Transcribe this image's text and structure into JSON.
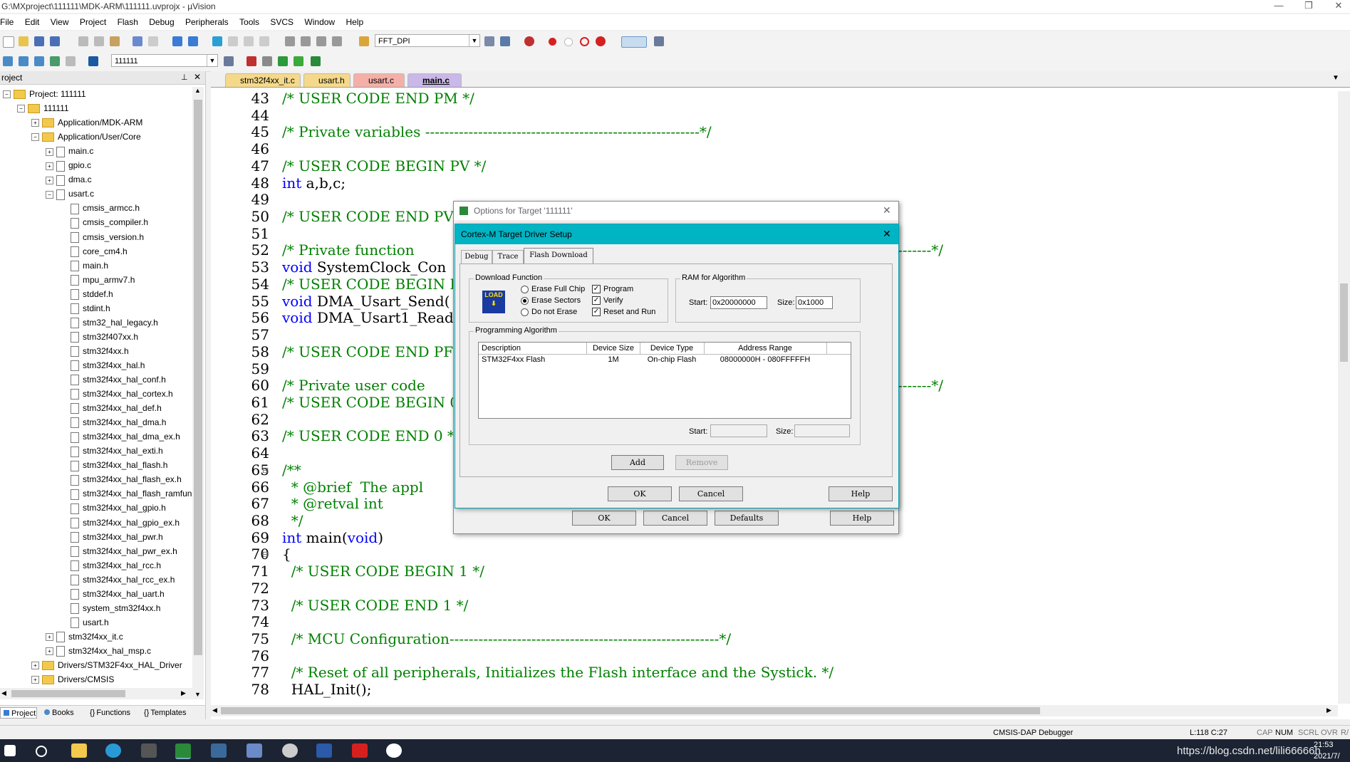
{
  "window": {
    "title": "G:\\MXproject\\111111\\MDK-ARM\\111111.uvprojx - µVision"
  },
  "menu": [
    "File",
    "Edit",
    "View",
    "Project",
    "Flash",
    "Debug",
    "Peripherals",
    "Tools",
    "SVCS",
    "Window",
    "Help"
  ],
  "toolbar1": {
    "combo_value": "FFT_DPI"
  },
  "toolbar2": {
    "target_value": "111111"
  },
  "project_panel": {
    "header": "roject",
    "pin": "⊥",
    "root": "Project: 111111",
    "target": "111111",
    "groups": {
      "mdk_arm": "Application/MDK-ARM",
      "user_core": "Application/User/Core",
      "hal_driver": "Drivers/STM32F4xx_HAL_Driver",
      "cmsis": "Drivers/CMSIS",
      "cmsis_node": "CMSIS"
    },
    "files": [
      "main.c",
      "gpio.c",
      "dma.c",
      "usart.c"
    ],
    "usart_includes": [
      "cmsis_armcc.h",
      "cmsis_compiler.h",
      "cmsis_version.h",
      "core_cm4.h",
      "main.h",
      "mpu_armv7.h",
      "stddef.h",
      "stdint.h",
      "stm32_hal_legacy.h",
      "stm32f407xx.h",
      "stm32f4xx.h",
      "stm32f4xx_hal.h",
      "stm32f4xx_hal_conf.h",
      "stm32f4xx_hal_cortex.h",
      "stm32f4xx_hal_def.h",
      "stm32f4xx_hal_dma.h",
      "stm32f4xx_hal_dma_ex.h",
      "stm32f4xx_hal_exti.h",
      "stm32f4xx_hal_flash.h",
      "stm32f4xx_hal_flash_ex.h",
      "stm32f4xx_hal_flash_ramfunc",
      "stm32f4xx_hal_gpio.h",
      "stm32f4xx_hal_gpio_ex.h",
      "stm32f4xx_hal_pwr.h",
      "stm32f4xx_hal_pwr_ex.h",
      "stm32f4xx_hal_rcc.h",
      "stm32f4xx_hal_rcc_ex.h",
      "stm32f4xx_hal_uart.h",
      "system_stm32f4xx.h",
      "usart.h"
    ],
    "more_files": [
      "stm32f4xx_it.c",
      "stm32f4xx_hal_msp.c"
    ],
    "tabs": [
      "Project",
      "Books",
      "Functions",
      "Templates"
    ]
  },
  "editor": {
    "tabs": [
      "stm32f4xx_it.c",
      "usart.h",
      "usart.c",
      "main.c"
    ],
    "active_tab": "main.c",
    "lines": [
      {
        "n": "43",
        "t": "/* USER CODE END PM */"
      },
      {
        "n": "44",
        "t": ""
      },
      {
        "n": "45",
        "t": "/* Private variables ---------------------------------------------------------*/"
      },
      {
        "n": "46",
        "t": ""
      },
      {
        "n": "47",
        "t": "/* USER CODE BEGIN PV */"
      },
      {
        "n": "48",
        "t": "int a,b,c;"
      },
      {
        "n": "49",
        "t": ""
      },
      {
        "n": "50",
        "t": "/* USER CODE END PV"
      },
      {
        "n": "51",
        "t": ""
      },
      {
        "n": "52",
        "t": "/* Private function"
      },
      {
        "n": "53",
        "t": "void SystemClock_Con"
      },
      {
        "n": "54",
        "t": "/* USER CODE BEGIN P"
      },
      {
        "n": "55",
        "t": "void DMA_Usart_Send("
      },
      {
        "n": "56",
        "t": "void DMA_Usart1_Read"
      },
      {
        "n": "57",
        "t": ""
      },
      {
        "n": "58",
        "t": "/* USER CODE END PFP"
      },
      {
        "n": "59",
        "t": ""
      },
      {
        "n": "60",
        "t": "/* Private user code"
      },
      {
        "n": "61",
        "t": "/* USER CODE BEGIN 0"
      },
      {
        "n": "62",
        "t": ""
      },
      {
        "n": "63",
        "t": "/* USER CODE END 0 *"
      },
      {
        "n": "64",
        "t": ""
      },
      {
        "n": "65",
        "t": "/**"
      },
      {
        "n": "66",
        "t": "  * @brief  The appl"
      },
      {
        "n": "67",
        "t": "  * @retval int"
      },
      {
        "n": "68",
        "t": "  */"
      },
      {
        "n": "69",
        "t": "int main(void)"
      },
      {
        "n": "70",
        "t": "{"
      },
      {
        "n": "71",
        "t": "  /* USER CODE BEGIN 1 */"
      },
      {
        "n": "72",
        "t": ""
      },
      {
        "n": "73",
        "t": "  /* USER CODE END 1 */"
      },
      {
        "n": "74",
        "t": ""
      },
      {
        "n": "75",
        "t": "  /* MCU Configuration--------------------------------------------------------*/"
      },
      {
        "n": "76",
        "t": ""
      },
      {
        "n": "77",
        "t": "  /* Reset of all peripherals, Initializes the Flash interface and the Systick. */"
      },
      {
        "n": "78",
        "t": "  HAL_Init();"
      }
    ],
    "right_tails": {
      "52": "-------*/",
      "60": "-------*/"
    }
  },
  "options_dialog": {
    "title": "Options for Target '111111'",
    "ok": "OK",
    "cancel": "Cancel",
    "defaults": "Defaults",
    "help": "Help"
  },
  "driver_dialog": {
    "title": "Cortex-M Target Driver Setup",
    "tabs": [
      "Debug",
      "Trace",
      "Flash Download"
    ],
    "download_function": {
      "title": "Download Function",
      "icon_text": "LOAD",
      "radios": [
        {
          "label": "Erase Full Chip",
          "on": false
        },
        {
          "label": "Erase Sectors",
          "on": true
        },
        {
          "label": "Do not Erase",
          "on": false
        }
      ],
      "checks": [
        {
          "label": "Program",
          "on": true
        },
        {
          "label": "Verify",
          "on": true
        },
        {
          "label": "Reset and Run",
          "on": true
        }
      ],
      "check_mark": "✓"
    },
    "ram": {
      "title": "RAM for Algorithm",
      "start_label": "Start:",
      "start": "0x20000000",
      "size_label": "Size:",
      "size": "0x1000"
    },
    "algo": {
      "title": "Programming Algorithm",
      "columns": [
        "Description",
        "Device Size",
        "Device Type",
        "Address Range"
      ],
      "rows": [
        [
          "STM32F4xx Flash",
          "1M",
          "On-chip Flash",
          "08000000H - 080FFFFFH"
        ]
      ],
      "start_label": "Start:",
      "size_label": "Size:"
    },
    "add": "Add",
    "remove": "Remove",
    "ok": "OK",
    "cancel": "Cancel",
    "help": "Help"
  },
  "status": {
    "debugger": "CMSIS-DAP Debugger",
    "pos": "L:118 C:27",
    "caps": "CAP",
    "num": "NUM",
    "scrl": "SCRL",
    "ovr": "OVR",
    "rw": "R/"
  },
  "watermark": "https://blog.csdn.net/lili66666h",
  "clock": {
    "time": "21:53",
    "date": "2021/7/"
  }
}
